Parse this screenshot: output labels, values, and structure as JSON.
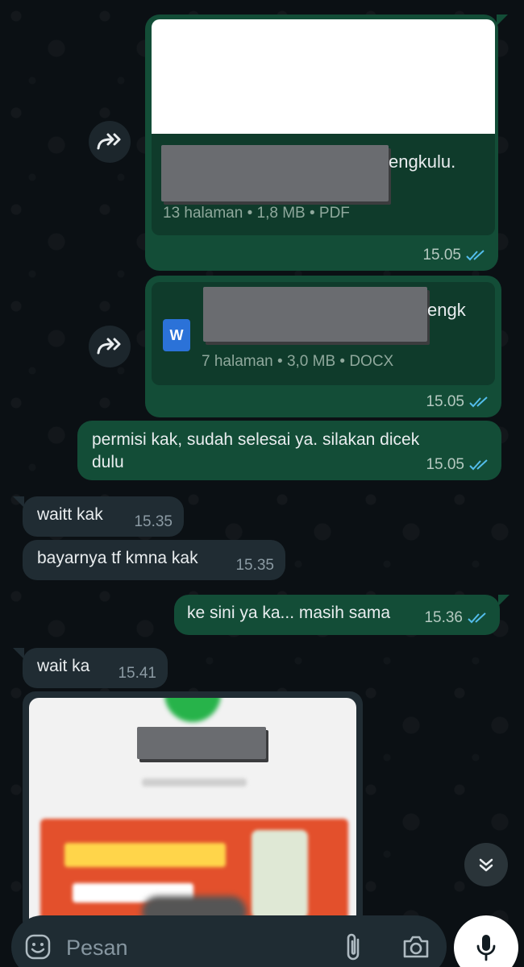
{
  "messages": {
    "doc1": {
      "title_suffix": "engkulu.",
      "meta": "13 halaman • 1,8 MB • PDF",
      "time": "15.05"
    },
    "doc2": {
      "title_suffix": "engk",
      "meta": "7 halaman • 3,0 MB • DOCX",
      "icon_letter": "W",
      "time": "15.05"
    },
    "out1": {
      "text_line1": "permisi kak, sudah selesai ya. silakan dicek",
      "text_line2": "dulu",
      "time": "15.05"
    },
    "in1": {
      "text": "waitt kak",
      "time": "15.35"
    },
    "in2": {
      "text": "bayarnya tf kmna kak",
      "time": "15.35"
    },
    "out2": {
      "text": "ke sini ya ka... masih sama",
      "time": "15.36"
    },
    "in3": {
      "text": "wait ka",
      "time": "15.41"
    }
  },
  "composer": {
    "placeholder": "Pesan"
  },
  "colors": {
    "outgoing_bubble": "#134d37",
    "incoming_bubble": "#202c33",
    "read_ticks": "#53bdeb",
    "background": "#0b1014"
  },
  "icons": [
    "forward-icon",
    "word-doc-icon",
    "read-ticks-icon",
    "scroll-down-icon",
    "emoji-icon",
    "attach-icon",
    "camera-icon",
    "mic-icon"
  ]
}
